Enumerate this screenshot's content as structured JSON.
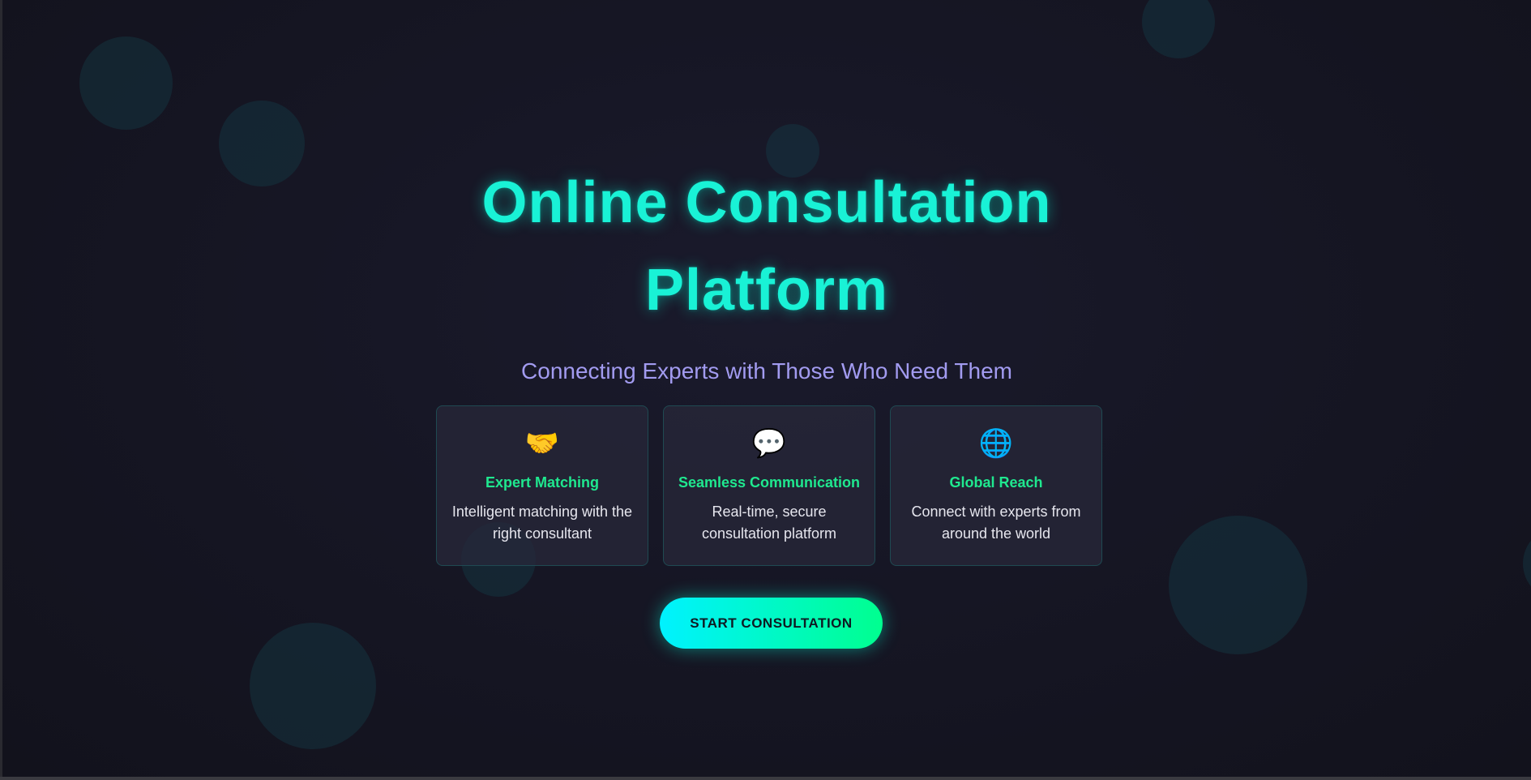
{
  "hero": {
    "title": "Online Consultation Platform",
    "subtitle": "Connecting Experts with Those Who Need Them"
  },
  "features": [
    {
      "icon": "handshake-icon",
      "glyph": "🤝",
      "title": "Expert Matching",
      "description": "Intelligent matching with the right consultant"
    },
    {
      "icon": "speech-bubble-icon",
      "glyph": "💬",
      "title": "Seamless Communication",
      "description": "Real-time, secure consultation platform"
    },
    {
      "icon": "globe-icon",
      "glyph": "🌐",
      "title": "Global Reach",
      "description": "Connect with experts from around the world"
    }
  ],
  "cta": {
    "label": "START CONSULTATION"
  },
  "colors": {
    "title": "#19f2d6",
    "subtitle": "#a29bf0",
    "feature_title": "#1fe88f",
    "cta_gradient_start": "#00f2ff",
    "cta_gradient_end": "#00ff8f"
  }
}
